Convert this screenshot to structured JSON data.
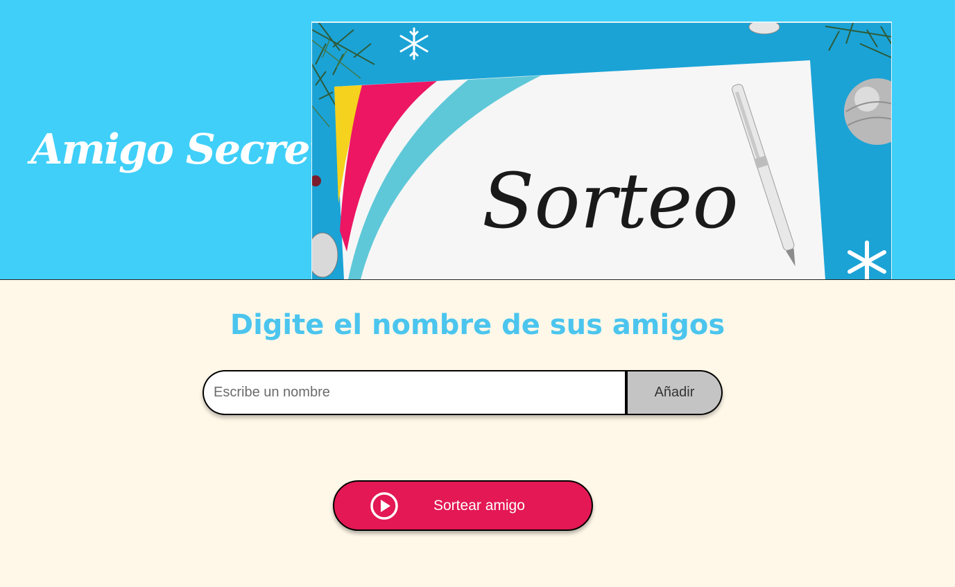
{
  "header": {
    "title": "Amigo Secreto",
    "banner_text": "Sorteo",
    "background_color": "#3fcff8"
  },
  "main": {
    "subtitle": "Digite el nombre de sus amigos",
    "name_input": {
      "value": "",
      "placeholder": "Escribe un nombre"
    },
    "add_button_label": "Añadir",
    "draw_button": {
      "icon": "play-circle-icon",
      "label": "Sortear amigo",
      "color": "#e31854"
    },
    "background_color": "#fff8e9",
    "accent_color": "#4bc5ee"
  }
}
